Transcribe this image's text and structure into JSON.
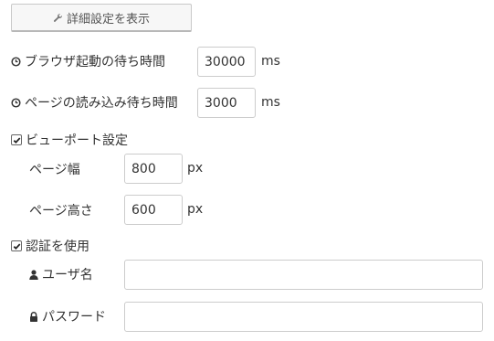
{
  "advanced_button": {
    "label": "詳細設定を表示",
    "icon": "wrench-icon"
  },
  "browser_timeout": {
    "label": "ブラウザ起動の待ち時間",
    "icon": "clock-icon",
    "value": "30000",
    "unit": "ms"
  },
  "page_timeout": {
    "label": "ページの読み込み待ち時間",
    "icon": "clock-icon",
    "value": "3000",
    "unit": "ms"
  },
  "viewport": {
    "checkbox_label": "ビューポート設定",
    "checked": true,
    "width_label": "ページ幅",
    "width_value": "800",
    "width_unit": "px",
    "height_label": "ページ高さ",
    "height_value": "600",
    "height_unit": "px"
  },
  "auth": {
    "checkbox_label": "認証を使用",
    "checked": true,
    "username_label": "ユーザ名",
    "username_icon": "user-icon",
    "username_value": "",
    "password_label": "パスワード",
    "password_icon": "lock-icon",
    "password_value": ""
  },
  "colors": {
    "text": "#333333",
    "border": "#cccccc",
    "button_bg": "#f7f7f7"
  }
}
